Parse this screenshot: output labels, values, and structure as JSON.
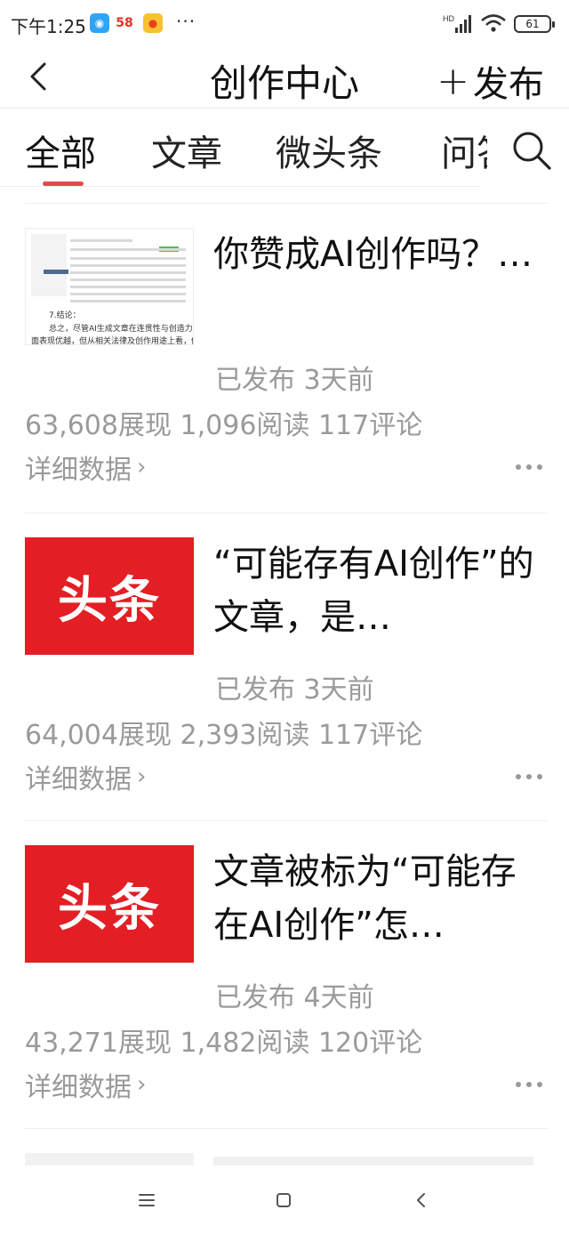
{
  "status_bar": {
    "time": "下午1:25",
    "app_icons": [
      "chat-app-icon",
      "58-app-icon",
      "game-app-icon"
    ],
    "app_58_label": "58",
    "more": "···",
    "network": "HD",
    "battery": "61"
  },
  "header": {
    "title": "创作中心",
    "publish_label": "发布"
  },
  "tabs": [
    {
      "label": "全部"
    },
    {
      "label": "文章"
    },
    {
      "label": "微头条"
    },
    {
      "label": "问答"
    }
  ],
  "articles": [
    {
      "title": "你赞成AI创作吗？…",
      "status": "已发布",
      "time": "3天前",
      "impressions": "63,608展现",
      "reads": "1,096阅读",
      "comments": "117评论",
      "detail_label": "详细数据",
      "thumb": {
        "type": "doc",
        "caption_1": "7.结论：",
        "caption_2": "总之，尽管AI生成文章在连贯性与创造力方",
        "caption_3": "面表现优越，但从相关法律及创作用途上看，仍"
      }
    },
    {
      "title": "“可能存有AI创作”的文章，是…",
      "status": "已发布",
      "time": "3天前",
      "impressions": "64,004展现",
      "reads": "2,393阅读",
      "comments": "117评论",
      "detail_label": "详细数据",
      "thumb": {
        "type": "brand",
        "text": "头条"
      }
    },
    {
      "title": "文章被标为“可能存在AI创作”怎…",
      "status": "已发布",
      "time": "4天前",
      "impressions": "43,271展现",
      "reads": "1,482阅读",
      "comments": "120评论",
      "detail_label": "详细数据",
      "thumb": {
        "type": "brand",
        "text": "头条"
      }
    }
  ],
  "colors": {
    "accent": "#e14b4b",
    "brand_red": "#e31e24",
    "muted_text": "#9a9a9a"
  }
}
